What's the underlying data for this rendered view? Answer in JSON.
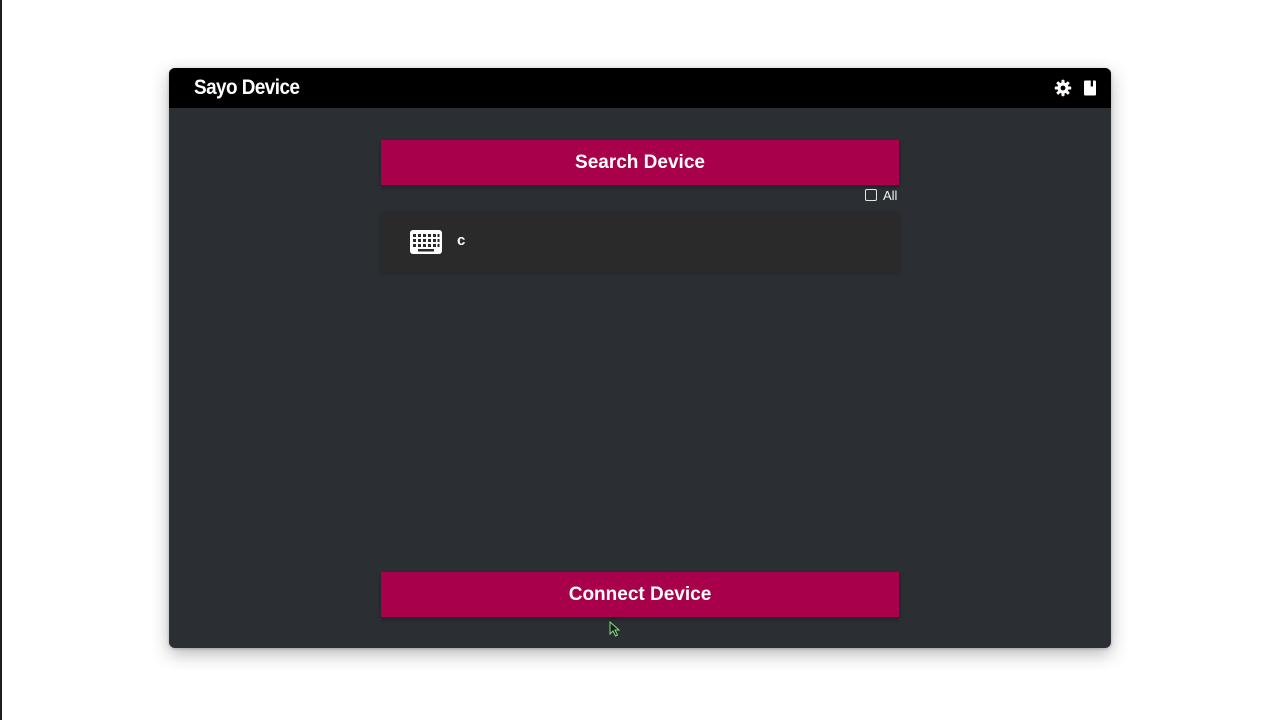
{
  "window": {
    "title": "Sayo Device"
  },
  "toolbar": {
    "settings_icon": "gear-icon",
    "docs_icon": "book-icon"
  },
  "search": {
    "button_label": "Search Device",
    "show_all_label": "All",
    "show_all_checked": false
  },
  "devices": [
    {
      "name": "c",
      "icon": "keyboard-icon"
    }
  ],
  "connect": {
    "button_label": "Connect Device"
  },
  "colors": {
    "accent": "#a8004a",
    "titlebar": "#000000",
    "content_bg": "#2b2f33",
    "list_item_bg": "#2a2a2a"
  }
}
